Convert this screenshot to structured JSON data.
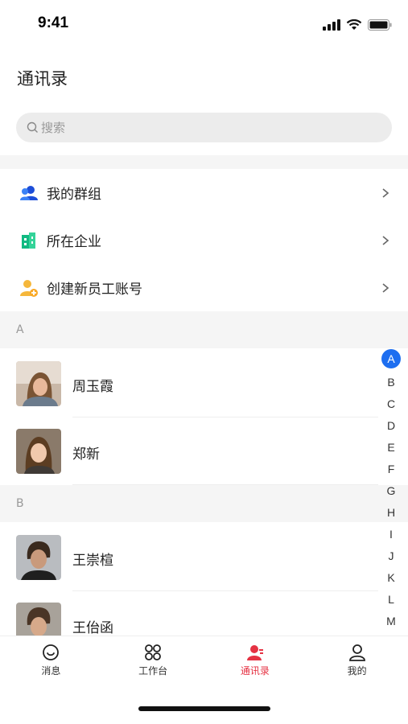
{
  "status_bar": {
    "time": "9:41"
  },
  "header": {
    "title": "通讯录"
  },
  "search": {
    "placeholder": "搜索"
  },
  "menu": [
    {
      "label": "我的群组",
      "icon": "group-icon",
      "color": "#1d4ed8"
    },
    {
      "label": "所在企业",
      "icon": "building-icon",
      "color": "#10b981"
    },
    {
      "label": "创建新员工账号",
      "icon": "add-user-icon",
      "color": "#f5b73b"
    }
  ],
  "sections": [
    {
      "letter": "A",
      "contacts": [
        {
          "name": "周玉霞"
        },
        {
          "name": "郑新"
        }
      ]
    },
    {
      "letter": "B",
      "contacts": [
        {
          "name": "王崇楦"
        },
        {
          "name": "王佁函"
        }
      ]
    }
  ],
  "index_letters": [
    "A",
    "B",
    "C",
    "D",
    "E",
    "F",
    "G",
    "H",
    "I",
    "J",
    "K",
    "L",
    "M"
  ],
  "tabs": [
    {
      "label": "消息",
      "icon": "message-icon"
    },
    {
      "label": "工作台",
      "icon": "workbench-icon"
    },
    {
      "label": "通讯录",
      "icon": "contacts-icon",
      "active": true
    },
    {
      "label": "我的",
      "icon": "profile-icon"
    }
  ],
  "colors": {
    "accent": "#1d6ef0",
    "active_tab": "#e53243"
  }
}
